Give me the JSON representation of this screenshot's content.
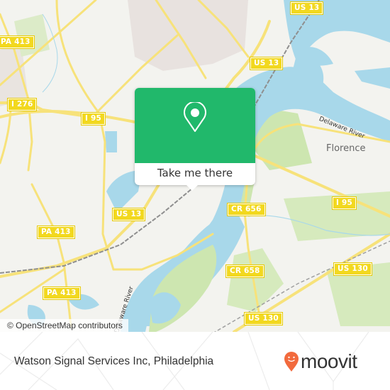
{
  "map": {
    "road_shields": [
      {
        "id": "us13-top",
        "label": "US 13"
      },
      {
        "id": "pa413-top",
        "label": "PA 413"
      },
      {
        "id": "us13-mid",
        "label": "US 13"
      },
      {
        "id": "i276",
        "label": "I 276"
      },
      {
        "id": "i95-left",
        "label": "I 95"
      },
      {
        "id": "i95-right",
        "label": "I 95"
      },
      {
        "id": "us13-lower",
        "label": "US 13"
      },
      {
        "id": "cr656",
        "label": "CR 656"
      },
      {
        "id": "pa413-mid",
        "label": "PA 413"
      },
      {
        "id": "cr658",
        "label": "CR 658"
      },
      {
        "id": "us130-right",
        "label": "US 130"
      },
      {
        "id": "pa413-low",
        "label": "PA 413"
      },
      {
        "id": "us130-low",
        "label": "US 130"
      }
    ],
    "places": [
      {
        "label": "Florence"
      }
    ],
    "water_labels": [
      {
        "label": "Delaware River"
      },
      {
        "label": "Delaware River"
      }
    ],
    "attribution": "© OpenStreetMap contributors",
    "colors": {
      "land": "#f3f3ef",
      "water": "#a8d8ea",
      "park": "#cde6b0",
      "road": "#f7e27a",
      "urban": "#e8e2df"
    }
  },
  "popup": {
    "icon": "map-pin-icon",
    "button_label": "Take me there",
    "color": "#21b86b"
  },
  "footer": {
    "place_name": "Watson Signal Services Inc, Philadelphia",
    "logo_text": "moovit",
    "logo_color": "#f26a3d"
  }
}
